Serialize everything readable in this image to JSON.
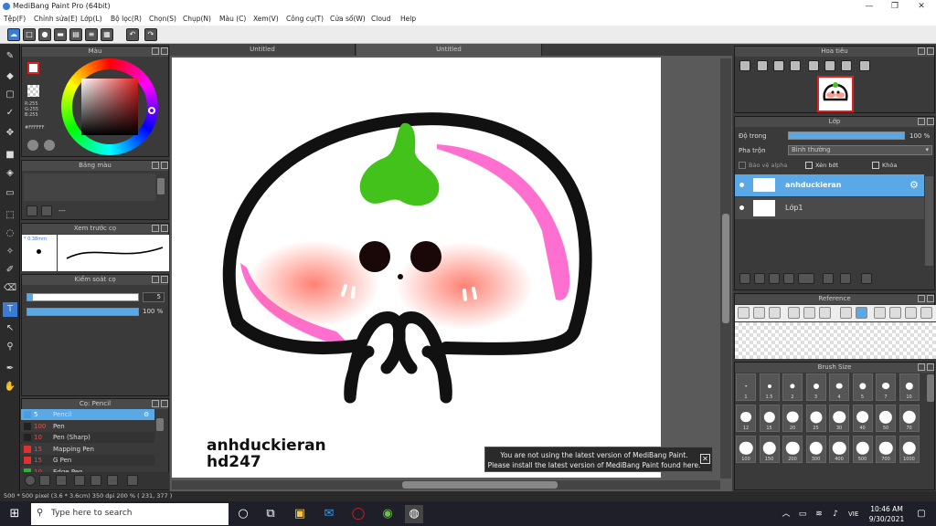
{
  "window": {
    "title": "MediBang Paint Pro (64bit)"
  },
  "menu": [
    "Tệp(F)",
    "Chỉnh sửa(E)",
    "Lớp(L)",
    "Bộ lọc(R)",
    "Chọn(S)",
    "Chụp(N)",
    "Màu (C)",
    "Xem(V)",
    "Công cụ(T)",
    "Cửa sổ(W)",
    "Cloud",
    "Help"
  ],
  "panels": {
    "color": {
      "title": "Màu",
      "r": "R:255",
      "g": "G:255",
      "b": "B:255",
      "hex": "#FFFFFF"
    },
    "palette": {
      "title": "Bảng màu",
      "dash": "---"
    },
    "brush_preview": {
      "title": "Xem trước cọ",
      "size": "* 0.38mm"
    },
    "brush_control": {
      "title": "Kiểm soát cọ",
      "size_value": "5",
      "opacity_value": "100 %",
      "size_fraction": 0.05,
      "opacity_fraction": 1.0
    },
    "brush_list": {
      "title": "Cọ: Pencil",
      "items": [
        {
          "size": "5",
          "name": "Pencil",
          "color": "#4a9de0"
        },
        {
          "size": "100",
          "name": "Pen",
          "color": "#222222"
        },
        {
          "size": "10",
          "name": "Pen (Sharp)",
          "color": "#222222"
        },
        {
          "size": "15",
          "name": "Mapping Pen",
          "color": "#e03030"
        },
        {
          "size": "15",
          "name": "G Pen",
          "color": "#e03030"
        },
        {
          "size": "10",
          "name": "Edge Pen",
          "color": "#30b030"
        }
      ]
    },
    "navigator": {
      "title": "Hoa tiêu"
    },
    "layer": {
      "title": "Lớp",
      "opacity_label": "Độ trong",
      "opacity_value": "100 %",
      "blend_label": "Pha trộn",
      "blend_value": "Bình thường",
      "alpha_label": "Bảo vệ alpha",
      "clip_label": "Xén bớt",
      "lock_label": "Khóa",
      "layers": [
        {
          "name": "anhduckieran",
          "selected": true
        },
        {
          "name": "Lớp1",
          "selected": false
        }
      ]
    },
    "reference": {
      "title": "Reference"
    },
    "brush_size": {
      "title": "Brush Size",
      "sizes": [
        "1",
        "1.5",
        "2",
        "3",
        "4",
        "5",
        "7",
        "10",
        "12",
        "15",
        "20",
        "25",
        "30",
        "40",
        "50",
        "70",
        "100",
        "150",
        "200",
        "300",
        "400",
        "500",
        "700",
        "1000"
      ]
    }
  },
  "tabs": [
    "Untitled",
    "Untitled"
  ],
  "artwork": {
    "signature_line1": "anhduckieran",
    "signature_line2": "hd247"
  },
  "notification": {
    "line1": "You are not using the latest version of MediBang Paint.",
    "line2": "Please install the latest version of MediBang Paint found here."
  },
  "status": {
    "text": "500 * 500 pixel  (3.6 * 3.6cm)  350 dpi  200 %  ( 231, 377 )"
  },
  "taskbar": {
    "search_placeholder": "Type here to search",
    "time": "10:46 AM",
    "date": "9/30/2021",
    "lang": "VIE"
  }
}
